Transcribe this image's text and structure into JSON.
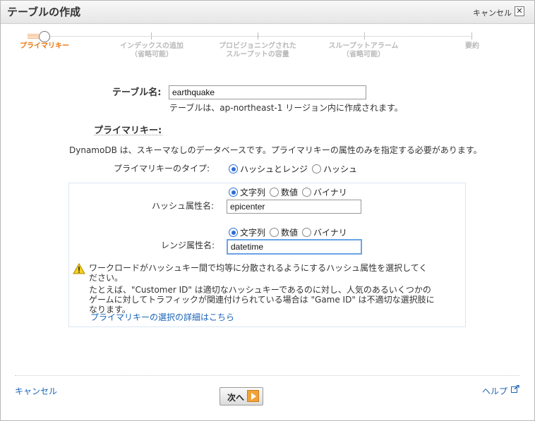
{
  "header": {
    "title": "テーブルの作成",
    "cancel_label": "キャンセル",
    "close_glyph": "✕"
  },
  "steps": [
    {
      "line1": "プライマリキー",
      "line2": "",
      "active": true
    },
    {
      "line1": "インデックスの追加",
      "line2": "（省略可能）",
      "active": false
    },
    {
      "line1": "プロビジョニングされた",
      "line2": "スループットの容量",
      "active": false
    },
    {
      "line1": "スループットアラーム",
      "line2": "（省略可能）",
      "active": false
    },
    {
      "line1": "要約",
      "line2": "",
      "active": false
    }
  ],
  "table_name": {
    "label": "テーブル名:",
    "value": "earthquake",
    "hint": "テーブルは、ap-northeast-1 リージョン内に作成されます。"
  },
  "primary_key": {
    "label": "プライマリキー:",
    "description": "DynamoDB は、スキーマなしのデータベースです。プライマリキーの属性のみを指定する必要があります。",
    "type_label": "プライマリキーのタイプ:",
    "type_options": [
      "ハッシュとレンジ",
      "ハッシュ"
    ],
    "type_selected": 0
  },
  "hash_attr": {
    "label": "ハッシュ属性名:",
    "types": [
      "文字列",
      "数値",
      "バイナリ"
    ],
    "selected": 0,
    "value": "epicenter"
  },
  "range_attr": {
    "label": "レンジ属性名:",
    "types": [
      "文字列",
      "数値",
      "バイナリ"
    ],
    "selected": 0,
    "value": "datetime"
  },
  "warning": {
    "line1": "ワークロードがハッシュキー間で均等に分散されるようにするハッシュ属性を選択してく",
    "line2": "ださい。",
    "line3": "たとえば、\"Customer ID\" は適切なハッシュキーであるのに対し、人気のあるいくつかの",
    "line4": "ゲームに対してトラフィックが関連付けられている場合は \"Game ID\" は不適切な選択肢に",
    "line5": "なります。",
    "link": "プライマリキーの選択の詳細はこちら"
  },
  "footer": {
    "cancel": "キャンセル",
    "next": "次へ",
    "help": "ヘルプ"
  },
  "colors": {
    "accent_orange": "#e8770f",
    "link_blue": "#1a63b8",
    "radio_blue": "#2c6ed8"
  }
}
